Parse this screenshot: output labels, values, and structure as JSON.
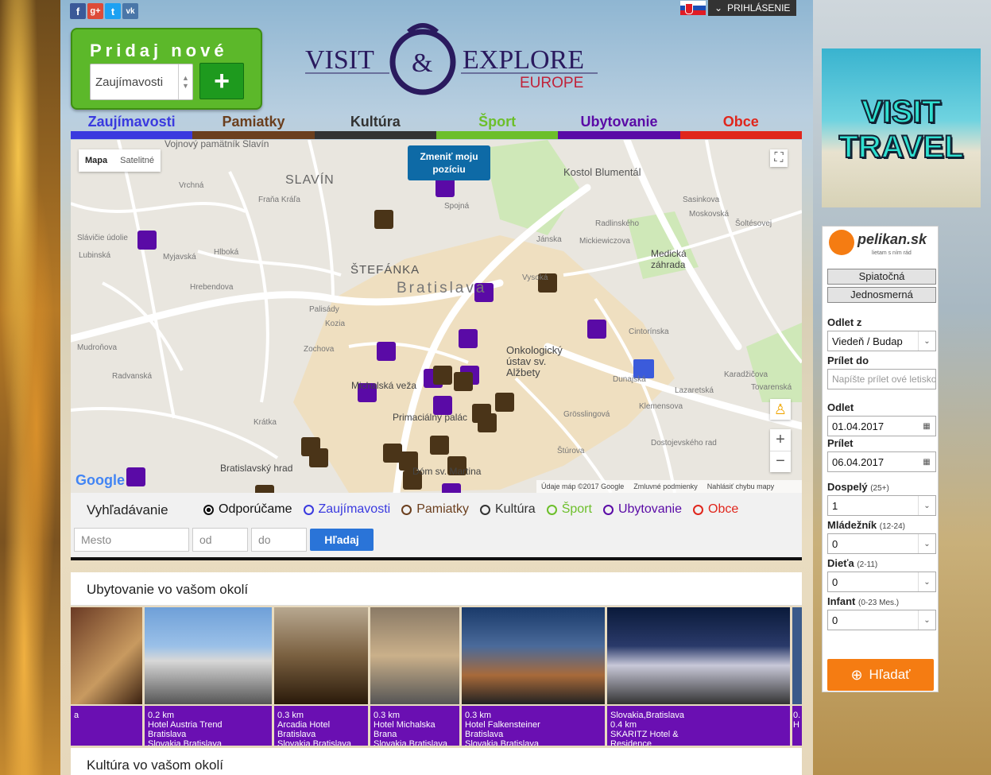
{
  "social": [
    "f",
    "g+",
    "t",
    "vk"
  ],
  "header": {
    "login_label": "PRIHLÁSENIE"
  },
  "add_new": {
    "title": "Pridaj nové",
    "select_value": "Zaujímavosti",
    "plus_label": "+"
  },
  "logo": {
    "line1_left": "VISIT",
    "ampersand": "&",
    "line1_right": "EXPLORE",
    "line2": "EUROPE"
  },
  "nav": [
    {
      "label": "Zaujímavosti",
      "color": "#3a3adf"
    },
    {
      "label": "Pamiatky",
      "color": "#6b3f1e"
    },
    {
      "label": "Kultúra",
      "color": "#333333"
    },
    {
      "label": "Šport",
      "color": "#6cbf2a"
    },
    {
      "label": "Ubytovanie",
      "color": "#5a0aa6"
    },
    {
      "label": "Obce",
      "color": "#e0261c"
    }
  ],
  "map": {
    "type_buttons": [
      "Mapa",
      "Satelitné"
    ],
    "change_position": "Zmeniť moju pozíciu",
    "labels": [
      "Vojnový pamätník Slavín",
      "SLAVÍN",
      "Kostol Blumentál",
      "ŠTEFÁNKA",
      "Bratislava",
      "Medická záhrada",
      "Onkologický ústav sv. Alžbety",
      "Michalská veža",
      "Primaciálny palác",
      "Bratislavský hrad",
      "Dóm sv. Martina",
      "Spojná",
      "Mudroňova",
      "Palisády",
      "Zochova",
      "Radvanská",
      "Kozia",
      "Grösslingová",
      "Dunajská",
      "Karadžičova",
      "Cintorínska",
      "Jánska",
      "Lazaretská",
      "Štúrova",
      "Krátka",
      "Hlboká",
      "Myjavská",
      "Hrebendova",
      "Mickiewiczova",
      "Moskovská",
      "Vysoká",
      "Šoltésovej",
      "Sasinkova",
      "Radlinského",
      "Dostojevského rad",
      "Klemensova",
      "Tovarenská",
      "Fraňa Kráľa",
      "Lubinská",
      "Slávičie údolie",
      "Vrchná"
    ],
    "attribution": "Údaje máp ©2017 Google",
    "terms": "Zmluvné podmienky",
    "report": "Nahlásiť chybu mapy",
    "google": "Google"
  },
  "search": {
    "title": "Vyhľadávanie",
    "options": [
      {
        "label": "Odporúčame",
        "color": "#111111",
        "selected": true
      },
      {
        "label": "Zaujímavosti",
        "color": "#3a3adf"
      },
      {
        "label": "Pamiatky",
        "color": "#6b3f1e"
      },
      {
        "label": "Kultúra",
        "color": "#333333"
      },
      {
        "label": "Šport",
        "color": "#6cbf2a"
      },
      {
        "label": "Ubytovanie",
        "color": "#5a0aa6"
      },
      {
        "label": "Obce",
        "color": "#e0261c"
      }
    ],
    "city_placeholder": "Mesto",
    "from_placeholder": "od",
    "to_placeholder": "do",
    "button": "Hľadaj"
  },
  "accommodation": {
    "title": "Ubytovanie vo vašom okolí",
    "cards": [
      {
        "line1": "",
        "line2": "a",
        "line3": ""
      },
      {
        "line1": "0.2 km",
        "line2": "Hotel Austria Trend",
        "line3": "Bratislava",
        "line4": "Slovakia,Bratislava"
      },
      {
        "line1": "0.3 km",
        "line2": "Arcadia Hotel",
        "line3": "Bratislava",
        "line4": "Slovakia,Bratislava"
      },
      {
        "line1": "0.3 km",
        "line2": "Hotel Michalska",
        "line3": "Brana",
        "line4": "Slovakia,Bratislava"
      },
      {
        "line1": "0.3 km",
        "line2": "Hotel Falkensteiner",
        "line3": "Bratislava",
        "line4": "Slovakia,Bratislava"
      },
      {
        "line1": "Slovakia,Bratislava",
        "line2": "0.4 km",
        "line3": "SKARITZ Hotel &",
        "line4": "Residence"
      },
      {
        "line1": "0.",
        "line2": "H",
        "line3": "",
        "line4": ""
      }
    ]
  },
  "culture": {
    "title": "Kultúra vo vašom okolí"
  },
  "ad": {
    "line1": "VISIT",
    "line2": "TRAVEL"
  },
  "pelikan": {
    "brand": "pelikan.sk",
    "tagline": "lietam s ním rád",
    "btn_return": "Spiatočná",
    "btn_oneway": "Jednosmerná",
    "from_label": "Odlet z",
    "from_value": "Viedeň / Budap",
    "to_label": "Prílet do",
    "to_placeholder": "Napíšte prílet ové letisko",
    "dep_label": "Odlet",
    "dep_value": "01.04.2017",
    "arr_label": "Prílet",
    "arr_value": "06.04.2017",
    "adult_label": "Dospelý",
    "adult_note": "(25+)",
    "adult_value": "1",
    "youth_label": "Mládežník",
    "youth_note": "(12-24)",
    "youth_value": "0",
    "child_label": "Dieťa",
    "child_note": "(2-11)",
    "child_value": "0",
    "infant_label": "Infant",
    "infant_note": "(0-23 Mes.)",
    "infant_value": "0",
    "search_label": "Hľadať"
  }
}
